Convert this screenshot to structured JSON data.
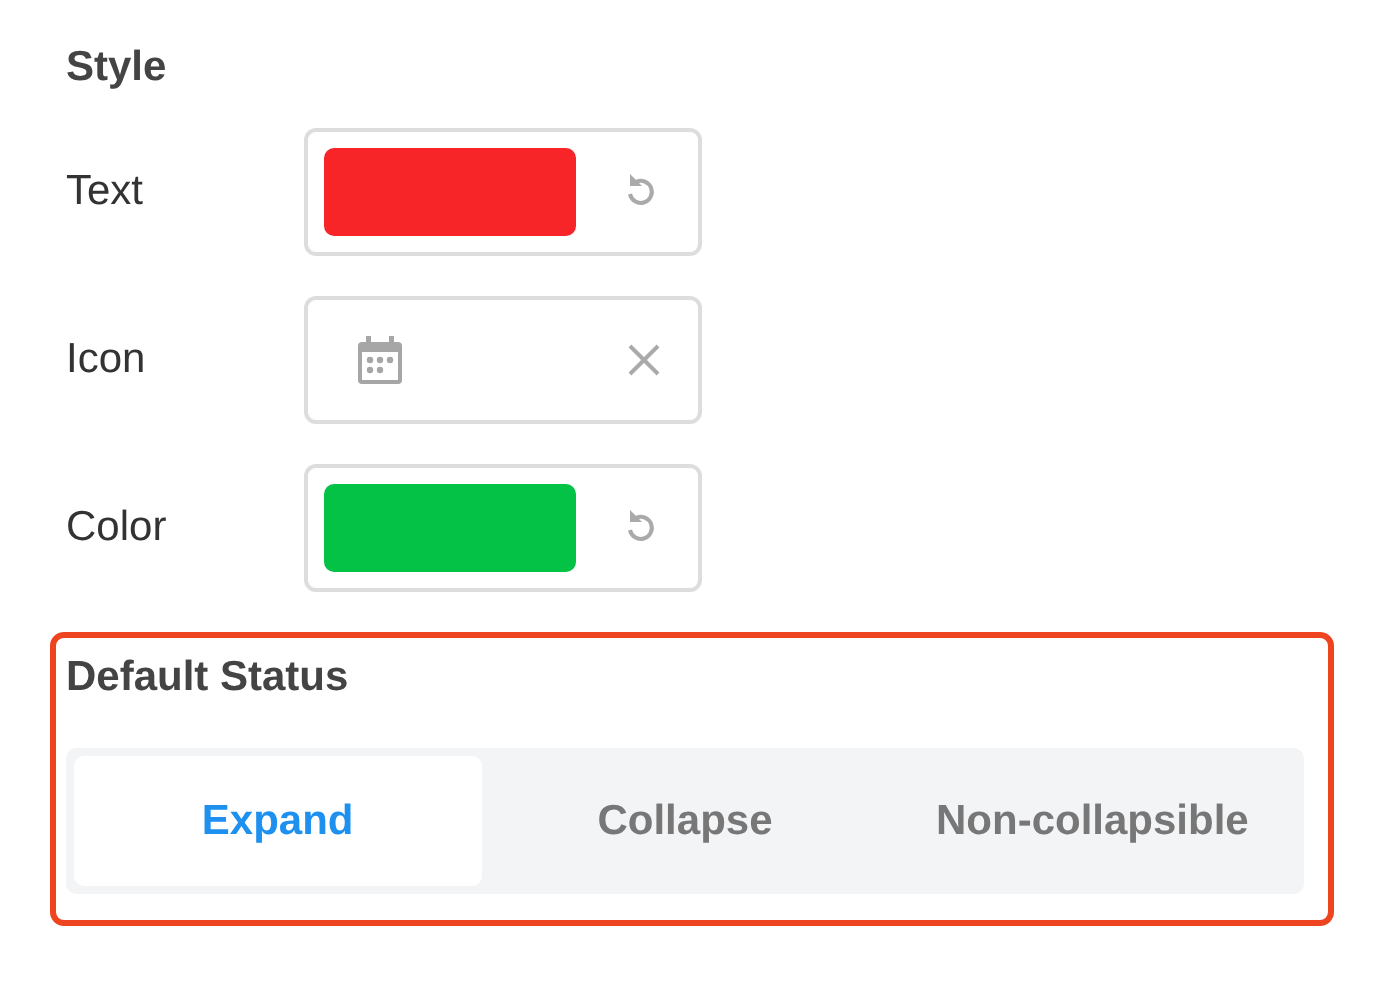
{
  "style_section": {
    "title": "Style",
    "rows": [
      {
        "label": "Text",
        "kind": "color",
        "color": "#f72428"
      },
      {
        "label": "Icon",
        "kind": "icon"
      },
      {
        "label": "Color",
        "kind": "color",
        "color": "#04c245"
      }
    ]
  },
  "default_status": {
    "title": "Default Status",
    "highlighted": true,
    "options": [
      {
        "label": "Expand",
        "selected": true
      },
      {
        "label": "Collapse",
        "selected": false
      },
      {
        "label": "Non-collapsible",
        "selected": false
      }
    ]
  }
}
